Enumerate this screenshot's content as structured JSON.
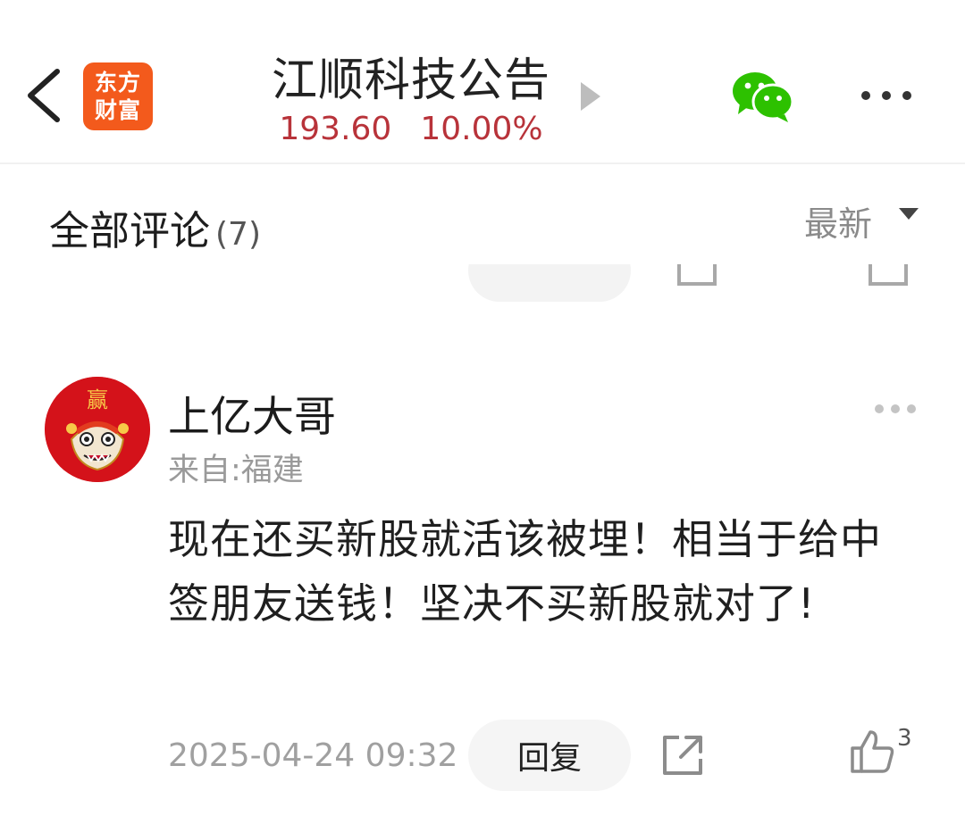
{
  "header": {
    "logo_line1": "东方",
    "logo_line2": "财富",
    "title": "江顺科技公告",
    "price": "193.60",
    "change": "10.00%"
  },
  "comments_section": {
    "label": "全部评论",
    "count": "(7)",
    "sort": "最新"
  },
  "comment": {
    "username": "上亿大哥",
    "location": "来自:福建",
    "body": "现在还买新股就活该被埋！相当于给中签朋友送钱！坚决不买新股就对了!",
    "date": "2025-04-24 09:32",
    "reply_label": "回复",
    "likes": "3",
    "avatar_glyph": "赢"
  },
  "icons": {
    "back": "back-chevron-icon",
    "wechat": "wechat-icon",
    "more": "more-dots-icon",
    "share": "share-icon",
    "like": "thumbs-up-icon"
  },
  "colors": {
    "brand_orange": "#f35a1c",
    "price_red": "#b8333a",
    "wechat_green": "#2dc100",
    "avatar_red": "#d4121a"
  }
}
